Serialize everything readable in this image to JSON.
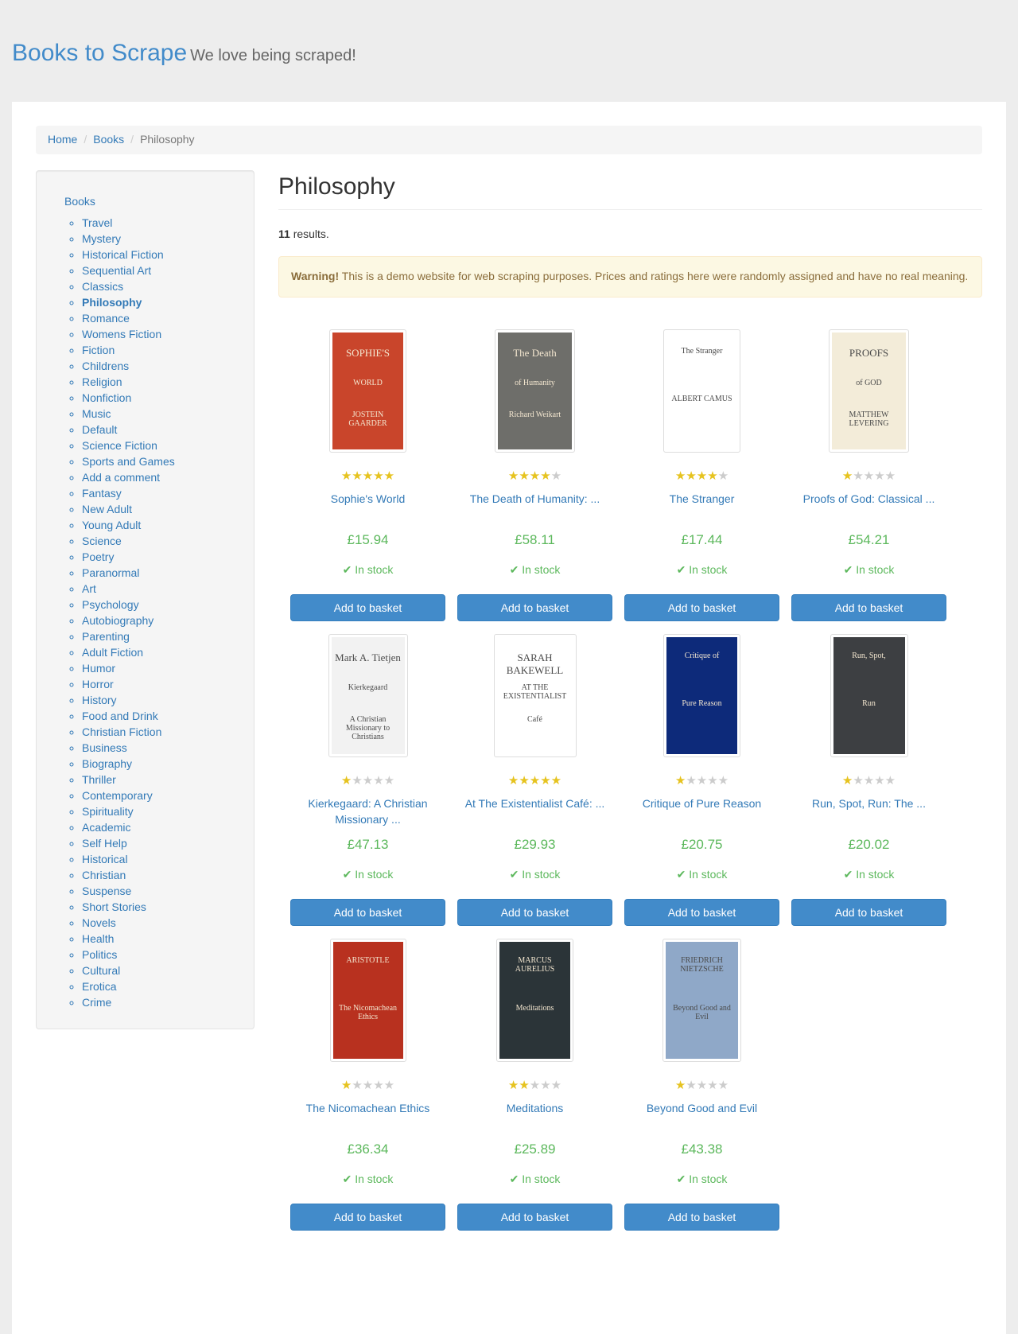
{
  "header": {
    "brand": "Books to Scrape",
    "tagline": "We love being scraped!"
  },
  "breadcrumb": {
    "home": "Home",
    "books": "Books",
    "current": "Philosophy"
  },
  "sidebar": {
    "root": "Books",
    "categories": [
      "Travel",
      "Mystery",
      "Historical Fiction",
      "Sequential Art",
      "Classics",
      "Philosophy",
      "Romance",
      "Womens Fiction",
      "Fiction",
      "Childrens",
      "Religion",
      "Nonfiction",
      "Music",
      "Default",
      "Science Fiction",
      "Sports and Games",
      "Add a comment",
      "Fantasy",
      "New Adult",
      "Young Adult",
      "Science",
      "Poetry",
      "Paranormal",
      "Art",
      "Psychology",
      "Autobiography",
      "Parenting",
      "Adult Fiction",
      "Humor",
      "Horror",
      "History",
      "Food and Drink",
      "Christian Fiction",
      "Business",
      "Biography",
      "Thriller",
      "Contemporary",
      "Spirituality",
      "Academic",
      "Self Help",
      "Historical",
      "Christian",
      "Suspense",
      "Short Stories",
      "Novels",
      "Health",
      "Politics",
      "Cultural",
      "Erotica",
      "Crime"
    ],
    "current": "Philosophy"
  },
  "main": {
    "title": "Philosophy",
    "results_count": "11",
    "results_suffix": " results.",
    "warning_strong": "Warning!",
    "warning_text": " This is a demo website for web scraping purposes. Prices and ratings here were randomly assigned and have no real meaning."
  },
  "books": [
    {
      "title": "Sophie's World",
      "price": "£15.94",
      "rating": 5,
      "stock": "In stock",
      "button": "Add to basket",
      "cover_lines": [
        "SOPHIE'S",
        "WORLD",
        "JOSTEIN GAARDER"
      ],
      "cover_color": "#c9452b"
    },
    {
      "title": "The Death of Humanity: ...",
      "price": "£58.11",
      "rating": 4,
      "stock": "In stock",
      "button": "Add to basket",
      "cover_lines": [
        "The Death",
        "of Humanity",
        "Richard Weikart"
      ],
      "cover_color": "#6e6e6a"
    },
    {
      "title": "The Stranger",
      "price": "£17.44",
      "rating": 4,
      "stock": "In stock",
      "button": "Add to basket",
      "cover_lines": [
        "The Stranger",
        "ALBERT CAMUS"
      ],
      "cover_color": "#ffffff"
    },
    {
      "title": "Proofs of God: Classical ...",
      "price": "£54.21",
      "rating": 1,
      "stock": "In stock",
      "button": "Add to basket",
      "cover_lines": [
        "PROOFS",
        "of GOD",
        "MATTHEW LEVERING"
      ],
      "cover_color": "#f3ecd9"
    },
    {
      "title": "Kierkegaard: A Christian Missionary ...",
      "price": "£47.13",
      "rating": 1,
      "stock": "In stock",
      "button": "Add to basket",
      "cover_lines": [
        "Mark A. Tietjen",
        "Kierkegaard",
        "A Christian Missionary to Christians"
      ],
      "cover_color": "#f2f2f2"
    },
    {
      "title": "At The Existentialist Café: ...",
      "price": "£29.93",
      "rating": 5,
      "stock": "In stock",
      "button": "Add to basket",
      "cover_lines": [
        "SARAH BAKEWELL",
        "AT THE EXISTENTIALIST",
        "Café"
      ],
      "cover_color": "#ffffff"
    },
    {
      "title": "Critique of Pure Reason",
      "price": "£20.75",
      "rating": 1,
      "stock": "In stock",
      "button": "Add to basket",
      "cover_lines": [
        "Critique of",
        "Pure Reason"
      ],
      "cover_color": "#0d2a7a"
    },
    {
      "title": "Run, Spot, Run: The ...",
      "price": "£20.02",
      "rating": 1,
      "stock": "In stock",
      "button": "Add to basket",
      "cover_lines": [
        "Run, Spot,",
        "Run"
      ],
      "cover_color": "#3d3f42"
    },
    {
      "title": "The Nicomachean Ethics",
      "price": "£36.34",
      "rating": 1,
      "stock": "In stock",
      "button": "Add to basket",
      "cover_lines": [
        "ARISTOTLE",
        "The Nicomachean Ethics"
      ],
      "cover_color": "#b8311f"
    },
    {
      "title": "Meditations",
      "price": "£25.89",
      "rating": 2,
      "stock": "In stock",
      "button": "Add to basket",
      "cover_lines": [
        "MARCUS AURELIUS",
        "Meditations"
      ],
      "cover_color": "#2b3438"
    },
    {
      "title": "Beyond Good and Evil",
      "price": "£43.38",
      "rating": 1,
      "stock": "In stock",
      "button": "Add to basket",
      "cover_lines": [
        "FRIEDRICH NIETZSCHE",
        "Beyond Good and Evil"
      ],
      "cover_color": "#8fa8c8"
    }
  ],
  "colors": {
    "brand": "#428bca",
    "link": "#337ab7",
    "price": "#5cb85c",
    "star_on": "#e6c31f",
    "star_off": "#cccccc",
    "button": "#428bca",
    "warning_bg": "#fcf8e3"
  },
  "icons": {
    "star": "star-icon",
    "stock": "check-icon"
  }
}
